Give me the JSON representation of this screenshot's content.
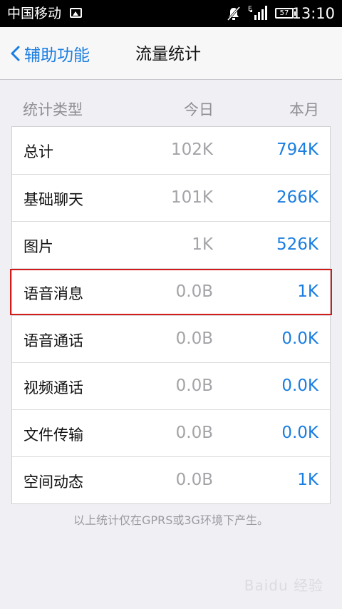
{
  "status_bar": {
    "carrier": "中国移动",
    "network": "E",
    "battery": "57",
    "time": "13:10"
  },
  "nav": {
    "back_label": "辅助功能",
    "title": "流量统计"
  },
  "table": {
    "headers": [
      "统计类型",
      "今日",
      "本月"
    ],
    "rows": [
      {
        "label": "总计",
        "today": "102K",
        "month": "794K"
      },
      {
        "label": "基础聊天",
        "today": "101K",
        "month": "266K"
      },
      {
        "label": "图片",
        "today": "1K",
        "month": "526K"
      },
      {
        "label": "语音消息",
        "today": "0.0B",
        "month": "1K"
      },
      {
        "label": "语音通话",
        "today": "0.0B",
        "month": "0.0K"
      },
      {
        "label": "视频通话",
        "today": "0.0B",
        "month": "0.0K"
      },
      {
        "label": "文件传输",
        "today": "0.0B",
        "month": "0.0K"
      },
      {
        "label": "空间动态",
        "today": "0.0B",
        "month": "1K"
      }
    ]
  },
  "footnote": "以上统计仅在GPRS或3G环境下产生。",
  "watermark": "Baidu 经验",
  "colors": {
    "accent": "#1a7ee0",
    "highlight_border": "#d21c1c",
    "background": "#efeff4"
  }
}
